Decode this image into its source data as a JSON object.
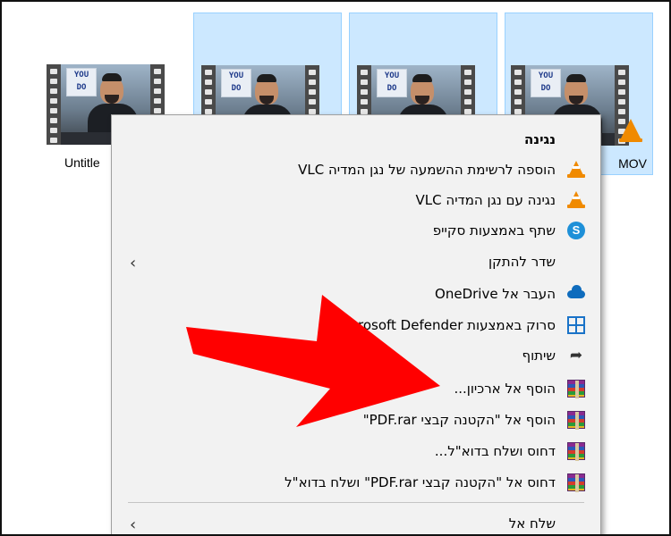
{
  "files": [
    {
      "name": "Untitle",
      "selected": false
    },
    {
      "name": "",
      "selected": true
    },
    {
      "name": "",
      "selected": true
    },
    {
      "name": "MOV",
      "selected": true
    }
  ],
  "thumbnail_poster_text": "YOU DO",
  "menu": {
    "items": [
      {
        "label": "נגינה",
        "icon": "none",
        "bold": true
      },
      {
        "label": "הוספה לרשימת ההשמעה של נגן המדיה VLC",
        "icon": "vlc-icon"
      },
      {
        "label": "נגינה עם נגן המדיה VLC",
        "icon": "vlc-icon"
      },
      {
        "label": "שתף באמצעות סקייפ",
        "icon": "skype-icon"
      },
      {
        "label": "שדר להתקן",
        "icon": "none",
        "submenu": true
      },
      {
        "label": "העבר אל OneDrive",
        "icon": "onedrive-icon"
      },
      {
        "label": "סרוק באמצעות Microsoft Defender...",
        "icon": "defender-icon"
      },
      {
        "label": "שיתוף",
        "icon": "share-icon"
      },
      {
        "label": "הוסף אל ארכיון...",
        "icon": "winrar-icon"
      },
      {
        "label": "הוסף אל \"הקטנה קבצי PDF.rar\"",
        "icon": "winrar-icon"
      },
      {
        "label": "דחוס ושלח בדוא\"ל...",
        "icon": "winrar-icon"
      },
      {
        "label": "דחוס אל \"הקטנה קבצי PDF.rar\" ושלח בדוא\"ל",
        "icon": "winrar-icon"
      },
      {
        "label": "שלח אל",
        "icon": "none",
        "submenu": true
      }
    ]
  },
  "colors": {
    "selection": "#cce8ff",
    "menu_bg": "#f2f2f2",
    "arrow": "#ff0000",
    "vlc_orange": "#f08a00"
  }
}
